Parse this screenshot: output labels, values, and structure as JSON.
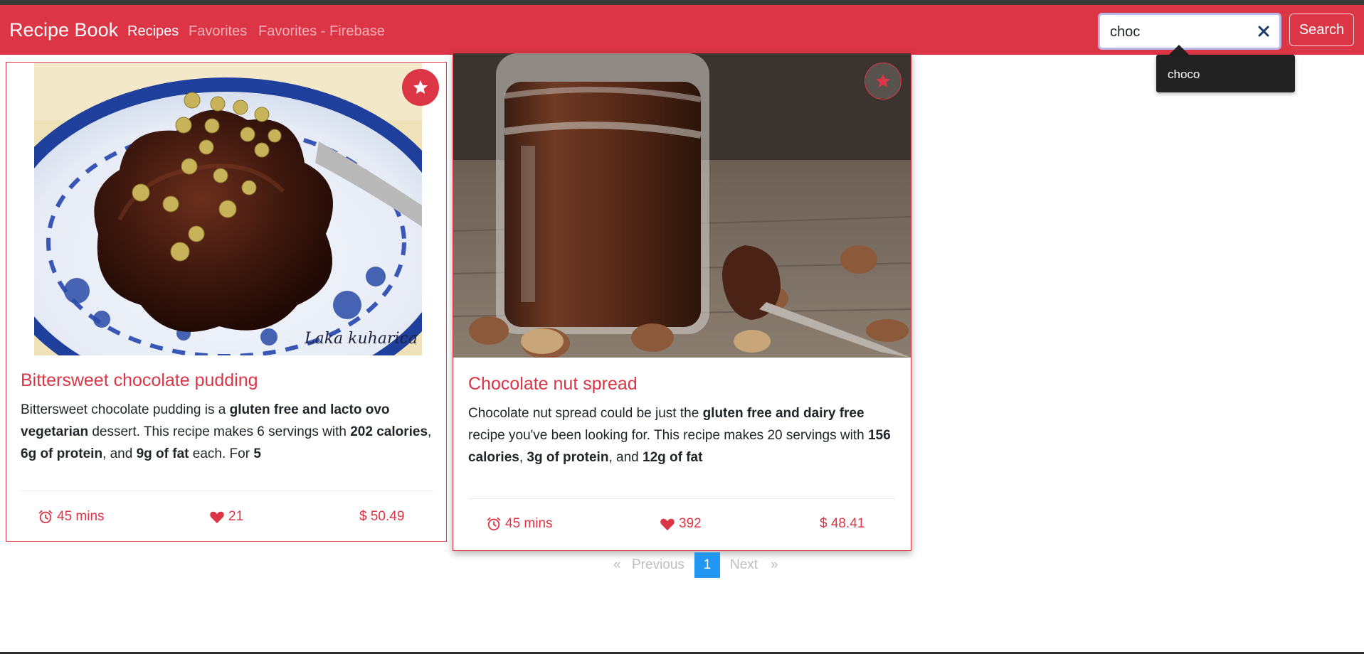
{
  "navbar": {
    "brand": "Recipe Book",
    "links": [
      {
        "label": "Recipes",
        "active": true
      },
      {
        "label": "Favorites",
        "active": false
      },
      {
        "label": "Favorites - Firebase",
        "active": false
      }
    ]
  },
  "search": {
    "value": "choc",
    "button_label": "Search",
    "suggestions": [
      "choco"
    ]
  },
  "recipes": [
    {
      "title": "Bittersweet chocolate pudding",
      "summary_parts": [
        {
          "t": "Bittersweet chocolate pudding is a ",
          "b": false
        },
        {
          "t": "gluten free and lacto ovo vegetarian",
          "b": true
        },
        {
          "t": " dessert. This recipe makes 6 servings with ",
          "b": false
        },
        {
          "t": "202 calories",
          "b": true
        },
        {
          "t": ", ",
          "b": false
        },
        {
          "t": "6g of protein",
          "b": true
        },
        {
          "t": ", and ",
          "b": false
        },
        {
          "t": "9g of fat",
          "b": true
        },
        {
          "t": " each. For ",
          "b": false
        },
        {
          "t": "5",
          "b": true
        }
      ],
      "time": "45 mins",
      "likes": "21",
      "price": "$ 50.49",
      "favorited": true,
      "image": "chocolate pudding on blue floral plate",
      "image_caption": "Laka kuharica"
    },
    {
      "title": "Chocolate nut spread",
      "summary_parts": [
        {
          "t": "Chocolate nut spread could be just the ",
          "b": false
        },
        {
          "t": "gluten free and dairy free",
          "b": true
        },
        {
          "t": " recipe you've been looking for. This recipe makes 20 servings with ",
          "b": false
        },
        {
          "t": "156 calories",
          "b": true
        },
        {
          "t": ", ",
          "b": false
        },
        {
          "t": "3g of protein",
          "b": true
        },
        {
          "t": ", and ",
          "b": false
        },
        {
          "t": "12g of fat",
          "b": true
        }
      ],
      "time": "45 mins",
      "likes": "392",
      "price": "$ 48.41",
      "favorited": false,
      "image": "jar of chocolate nut spread with nuts"
    }
  ],
  "pagination": {
    "first": "«",
    "previous": "Previous",
    "current": "1",
    "next": "Next",
    "last": "»"
  },
  "colors": {
    "brand": "#dc3545",
    "pagination_active": "#2196f3",
    "tooltip_bg": "#222222"
  }
}
